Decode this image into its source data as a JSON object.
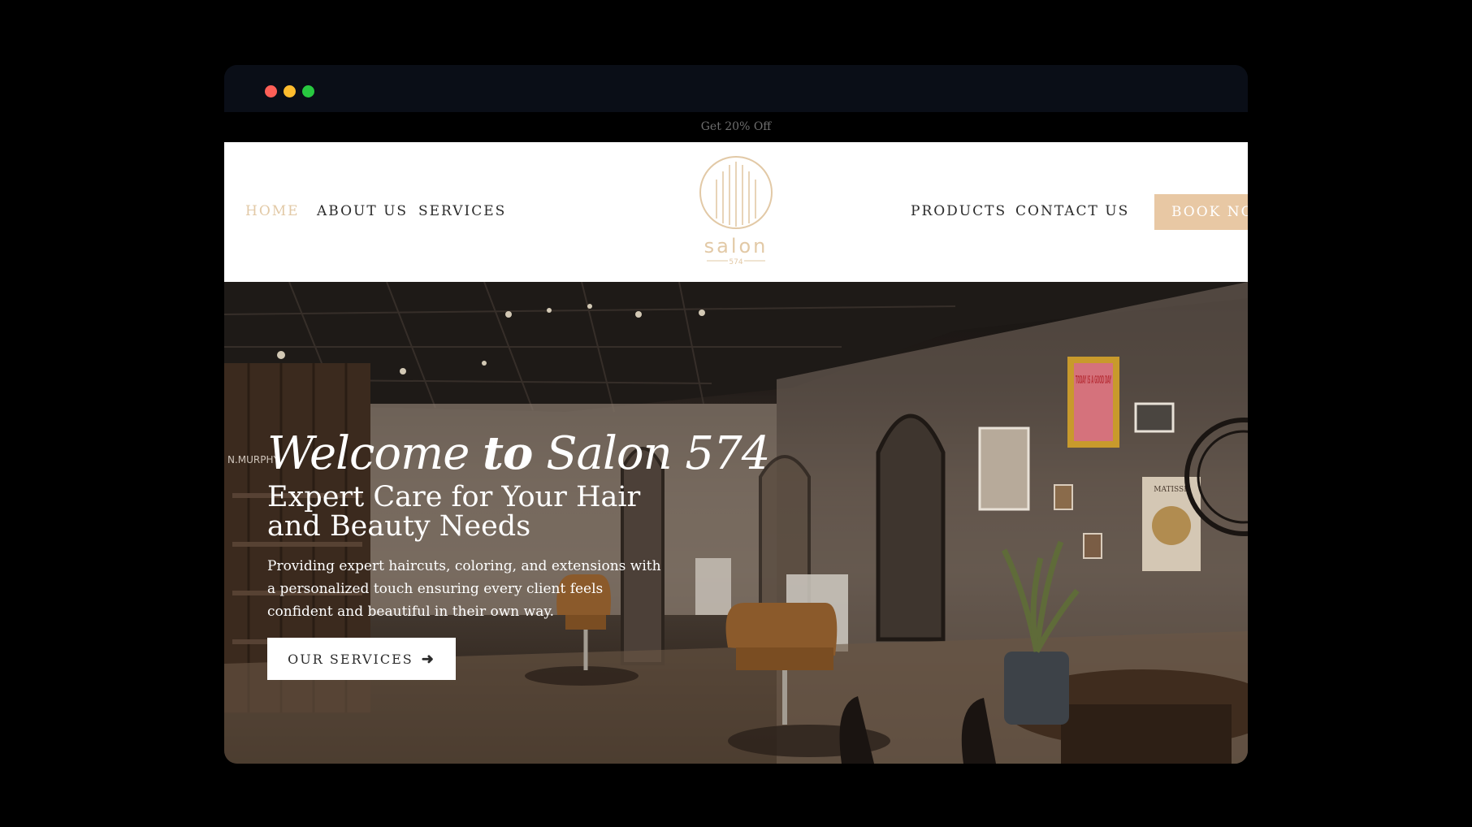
{
  "window": {
    "controls": [
      "close",
      "minimize",
      "maximize"
    ]
  },
  "promo": {
    "text": "Get 20% Off"
  },
  "nav": {
    "left": [
      {
        "label": "HOME",
        "active": true
      },
      {
        "label": "ABOUT US"
      },
      {
        "label": "SERVICES"
      }
    ],
    "right": [
      {
        "label": "PRODUCTS"
      },
      {
        "label": "CONTACT US"
      }
    ],
    "book_label": "BOOK NOW",
    "logo": {
      "name": "salon",
      "number": "574"
    }
  },
  "hero": {
    "title_prefix": "Welcome ",
    "title_emph": "to",
    "title_suffix": " Salon 574",
    "subtitle": "Expert Care for Your Hair and Beauty Needs",
    "description": "Providing expert haircuts, coloring, and extensions with a personalized touch ensuring every client feels confident and beautiful in their own way.",
    "button_label": "OUR SERVICES",
    "button_icon": "arrow-right-icon",
    "poster_text": "TODAY IS A GOOD DAY",
    "matisse_text": "MATISSE",
    "sign_text": "N.MURPHY"
  },
  "colors": {
    "accent": "#e2c9a6",
    "button_accent": "#e8c8a4",
    "promo_bg": "#000000",
    "frame_bg": "#0a0e17"
  }
}
